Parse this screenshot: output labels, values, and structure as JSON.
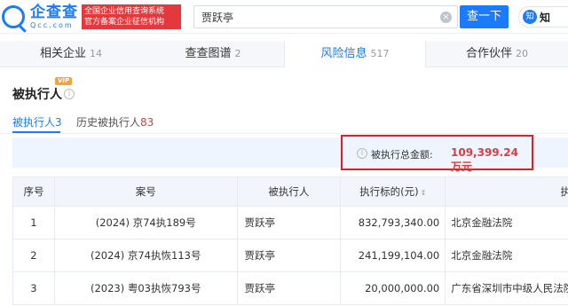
{
  "topbar": {
    "logo_name": "企查查",
    "logo_domain": "Qcc.com",
    "logo_badge_lines": [
      "全国企业信用查询系统",
      "官方备案企业征信机构"
    ],
    "search_value": "贾跃亭",
    "search_button": "查一下",
    "zhi_label": "知",
    "zhi_icon": "知"
  },
  "tabs": [
    {
      "label": "相关企业",
      "count": "14"
    },
    {
      "label": "查查图谱",
      "count": "2"
    },
    {
      "label": "风险信息",
      "count": "517"
    },
    {
      "label": "合作伙伴",
      "count": "20"
    }
  ],
  "section": {
    "title": "被执行人",
    "vip_badge": "VIP",
    "info_icon": "i"
  },
  "subtabs": [
    {
      "label": "被执行人",
      "count": "3"
    },
    {
      "label": "历史被执行人",
      "count": "83"
    }
  ],
  "summary": {
    "info_icon": "i",
    "label": "被执行总金额:",
    "value": "109,399.24 万元"
  },
  "table": {
    "headers": [
      "序号",
      "案号",
      "被执行人",
      "执行标的(元)",
      "执"
    ],
    "sort_icon": "⇕",
    "rows": [
      {
        "idx": "1",
        "case": "(2024) 京74执189号",
        "person": "贾跃亭",
        "amount": "832,793,340.00",
        "court": "北京金融法院"
      },
      {
        "idx": "2",
        "case": "(2024) 京74执恢113号",
        "person": "贾跃亭",
        "amount": "241,199,104.00",
        "court": "北京金融法院"
      },
      {
        "idx": "3",
        "case": "(2023) 粤03执恢793号",
        "person": "贾跃亭",
        "amount": "20,000,000.00",
        "court": "广东省深圳市中级人民法院"
      }
    ]
  },
  "colors": {
    "brand_blue": "#1a7bff",
    "risk_red": "#e4393c",
    "highlight_border": "#e02020"
  }
}
